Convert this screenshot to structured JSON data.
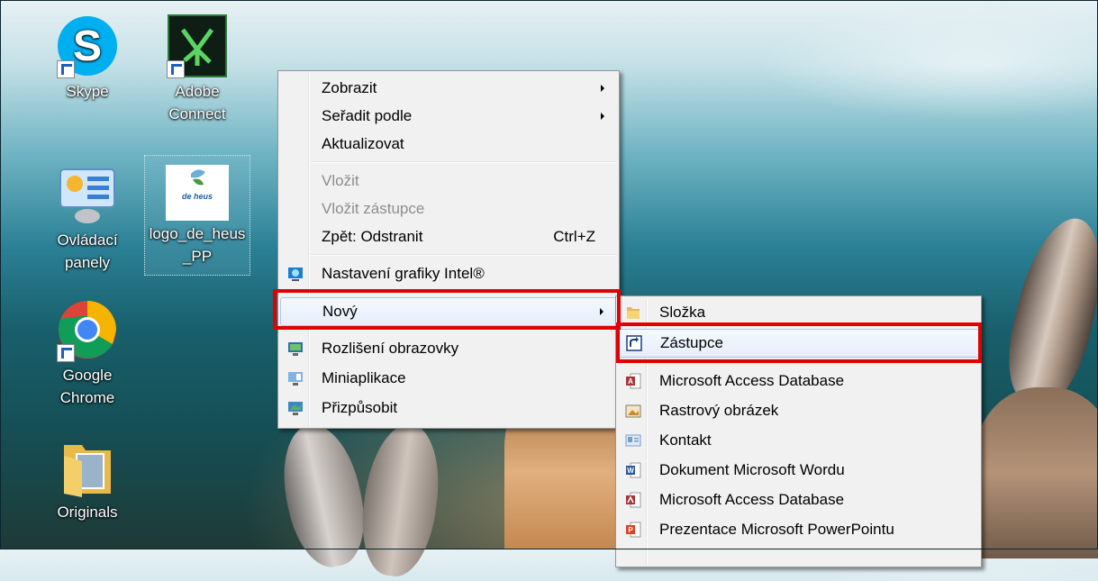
{
  "desktop": {
    "icons": [
      {
        "label": "Skype",
        "icon": "skype-icon"
      },
      {
        "label_line1": "Adobe",
        "label_line2": "Connect",
        "icon": "adobe-connect-icon"
      },
      {
        "label_line1": "Ovládací",
        "label_line2": "panely",
        "icon": "control-panel-icon"
      },
      {
        "label_line1": "logo_de_heus",
        "label_line2": "_PP",
        "icon": "image-file-icon",
        "logo_text": "de heus"
      },
      {
        "label_line1": "Google",
        "label_line2": "Chrome",
        "icon": "chrome-icon"
      },
      {
        "label": "Originals",
        "icon": "folder-icon"
      }
    ]
  },
  "context_menu": {
    "items": [
      {
        "label": "Zobrazit",
        "submenu": true
      },
      {
        "label": "Seřadit podle",
        "submenu": true
      },
      {
        "label": "Aktualizovat"
      },
      {
        "label": "Vložit",
        "disabled": true
      },
      {
        "label": "Vložit zástupce",
        "disabled": true
      },
      {
        "label": "Zpět: Odstranit",
        "shortcut": "Ctrl+Z"
      },
      {
        "label": "Nastavení grafiky Intel®",
        "icon": "intel-graphics-icon"
      },
      {
        "label": "Nový",
        "submenu": true,
        "highlighted": true
      },
      {
        "label": "Rozlišení obrazovky",
        "icon": "screen-resolution-icon"
      },
      {
        "label": "Miniaplikace",
        "icon": "gadgets-icon"
      },
      {
        "label": "Přizpůsobit",
        "icon": "personalize-icon"
      }
    ]
  },
  "new_submenu": {
    "items": [
      {
        "label": "Složka",
        "icon": "folder-icon"
      },
      {
        "label": "Zástupce",
        "icon": "shortcut-icon",
        "highlighted": true
      },
      {
        "label": "Microsoft Access Database",
        "icon": "access-icon"
      },
      {
        "label": "Rastrový obrázek",
        "icon": "bitmap-icon"
      },
      {
        "label": "Kontakt",
        "icon": "contact-icon"
      },
      {
        "label": "Dokument Microsoft Wordu",
        "icon": "word-icon"
      },
      {
        "label": "Microsoft Access Database",
        "icon": "access-icon"
      },
      {
        "label": "Prezentace Microsoft PowerPointu",
        "icon": "powerpoint-icon"
      }
    ]
  },
  "colors": {
    "highlight_box": "#e00000",
    "menu_bg": "#f1f1f1"
  }
}
